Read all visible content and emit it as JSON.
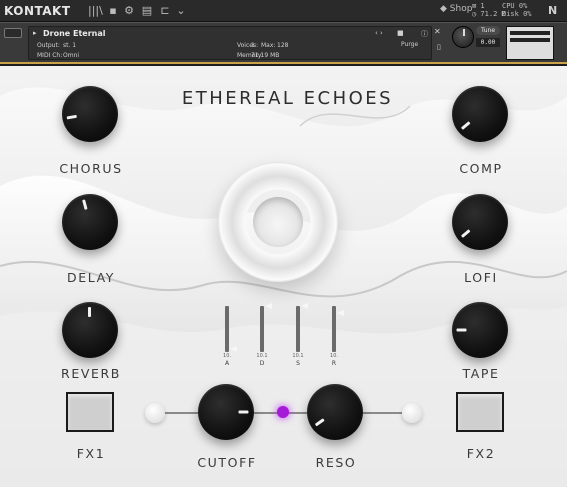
{
  "topbar": {
    "brand": "KONTAKT",
    "icons": [
      "library-icon",
      "save-icon",
      "gear-icon",
      "view-icon",
      "plug-icon",
      "chevron-down-icon"
    ],
    "icon_glyphs": [
      "|||\\",
      "▪",
      "⚙",
      "▤",
      "⊏",
      "⌄"
    ],
    "shop_label": "Shop",
    "stats_mid": [
      "⊠ 1",
      "◷ 71.2 M"
    ],
    "stats_right": [
      "CPU 0%",
      "Disk 0%"
    ]
  },
  "header": {
    "instrument_name": "Drone Eternal",
    "output_label": "Output:",
    "output_value": "st. 1",
    "midi_label": "MIDI Ch:",
    "midi_value": "Omni",
    "voices_label": "Voices:",
    "voices_value": "1",
    "max_label": "Max:",
    "max_value": "128",
    "memory_label": "Memory:",
    "memory_value": "71.19 MB",
    "purge_label": "Purge",
    "tune_label": "Tune",
    "tune_value": "0.00"
  },
  "panel": {
    "title": "ETHEREAL ECHOES",
    "knobs": {
      "chorus": {
        "label": "CHORUS",
        "angle": -100
      },
      "comp": {
        "label": "COMP",
        "angle": -130
      },
      "delay": {
        "label": "DELAY",
        "angle": -15
      },
      "lofi": {
        "label": "LOFI",
        "angle": -130
      },
      "reverb": {
        "label": "REVERB",
        "angle": 0
      },
      "tape": {
        "label": "TAPE",
        "angle": -90
      },
      "cutoff": {
        "label": "CUTOFF",
        "angle": 90
      },
      "reso": {
        "label": "RESO",
        "angle": -125
      }
    },
    "adsr": [
      {
        "name": "A",
        "value": "10."
      },
      {
        "name": "D",
        "value": "10.1"
      },
      {
        "name": "S",
        "value": "10.1"
      },
      {
        "name": "R",
        "value": "10."
      }
    ],
    "fx1_label": "FX1",
    "fx2_label": "FX2"
  },
  "colors": {
    "accent_gold": "#caa24a",
    "link_dot": "#a51ad6"
  }
}
